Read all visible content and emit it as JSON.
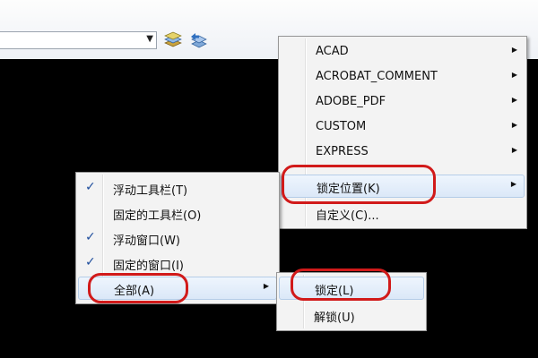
{
  "main_menu": {
    "items": [
      {
        "label": "ACAD"
      },
      {
        "label": "ACROBAT_COMMENT"
      },
      {
        "label": "ADOBE_PDF"
      },
      {
        "label": "CUSTOM"
      },
      {
        "label": "EXPRESS"
      },
      {
        "label": "锁定位置(K)"
      },
      {
        "label": "自定义(C)..."
      }
    ]
  },
  "lock_menu": {
    "items": [
      {
        "label": "浮动工具栏(T)",
        "checked": true
      },
      {
        "label": "固定的工具栏(O)",
        "checked": false
      },
      {
        "label": "浮动窗口(W)",
        "checked": true
      },
      {
        "label": "固定的窗口(I)",
        "checked": true
      },
      {
        "label": "全部(A)",
        "checked": false
      }
    ]
  },
  "all_menu": {
    "items": [
      {
        "label": "锁定(L)"
      },
      {
        "label": "解锁(U)"
      }
    ]
  },
  "icons": {
    "checkmark": "✓",
    "submenu_arrow": "▶",
    "dropdown_arrow": "▼"
  },
  "colors": {
    "highlight_ring": "#d11a1a",
    "menu_background": "#f3f3f3",
    "canvas_background": "#000000",
    "check_color": "#1f4e9d"
  }
}
